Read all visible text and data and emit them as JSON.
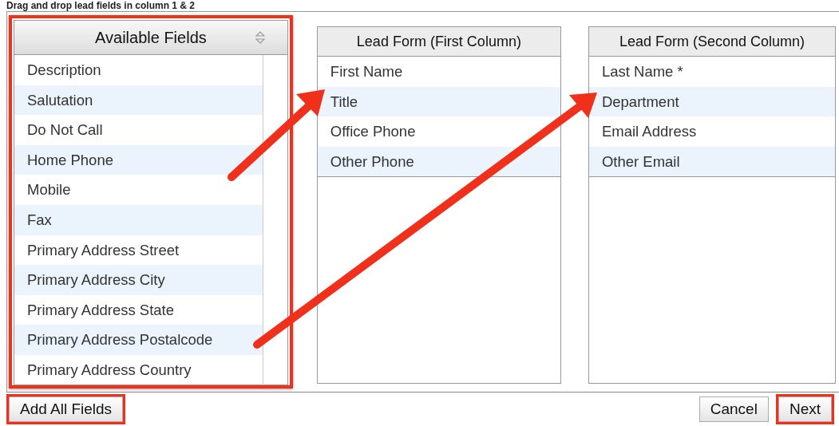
{
  "instruction": "Drag and drop lead fields in column 1 & 2",
  "panels": [
    {
      "title": "Available Fields",
      "sortable": true,
      "highlighted": true,
      "items": [
        "Description",
        "Salutation",
        "Do Not Call",
        "Home Phone",
        "Mobile",
        "Fax",
        "Primary Address Street",
        "Primary Address City",
        "Primary Address State",
        "Primary Address Postalcode",
        "Primary Address Country"
      ]
    },
    {
      "title": "Lead Form (First Column)",
      "sortable": false,
      "highlighted": false,
      "items": [
        "First Name",
        "Title",
        "Office Phone",
        "Other Phone"
      ]
    },
    {
      "title": "Lead Form (Second Column)",
      "sortable": false,
      "highlighted": false,
      "items": [
        "Last Name *",
        "Department",
        "Email Address",
        "Other Email"
      ]
    }
  ],
  "left_buttons": [
    {
      "label": "Add All Fields",
      "highlighted": true
    }
  ],
  "right_buttons": [
    {
      "label": "Cancel",
      "highlighted": false
    },
    {
      "label": "Next",
      "highlighted": true
    }
  ]
}
